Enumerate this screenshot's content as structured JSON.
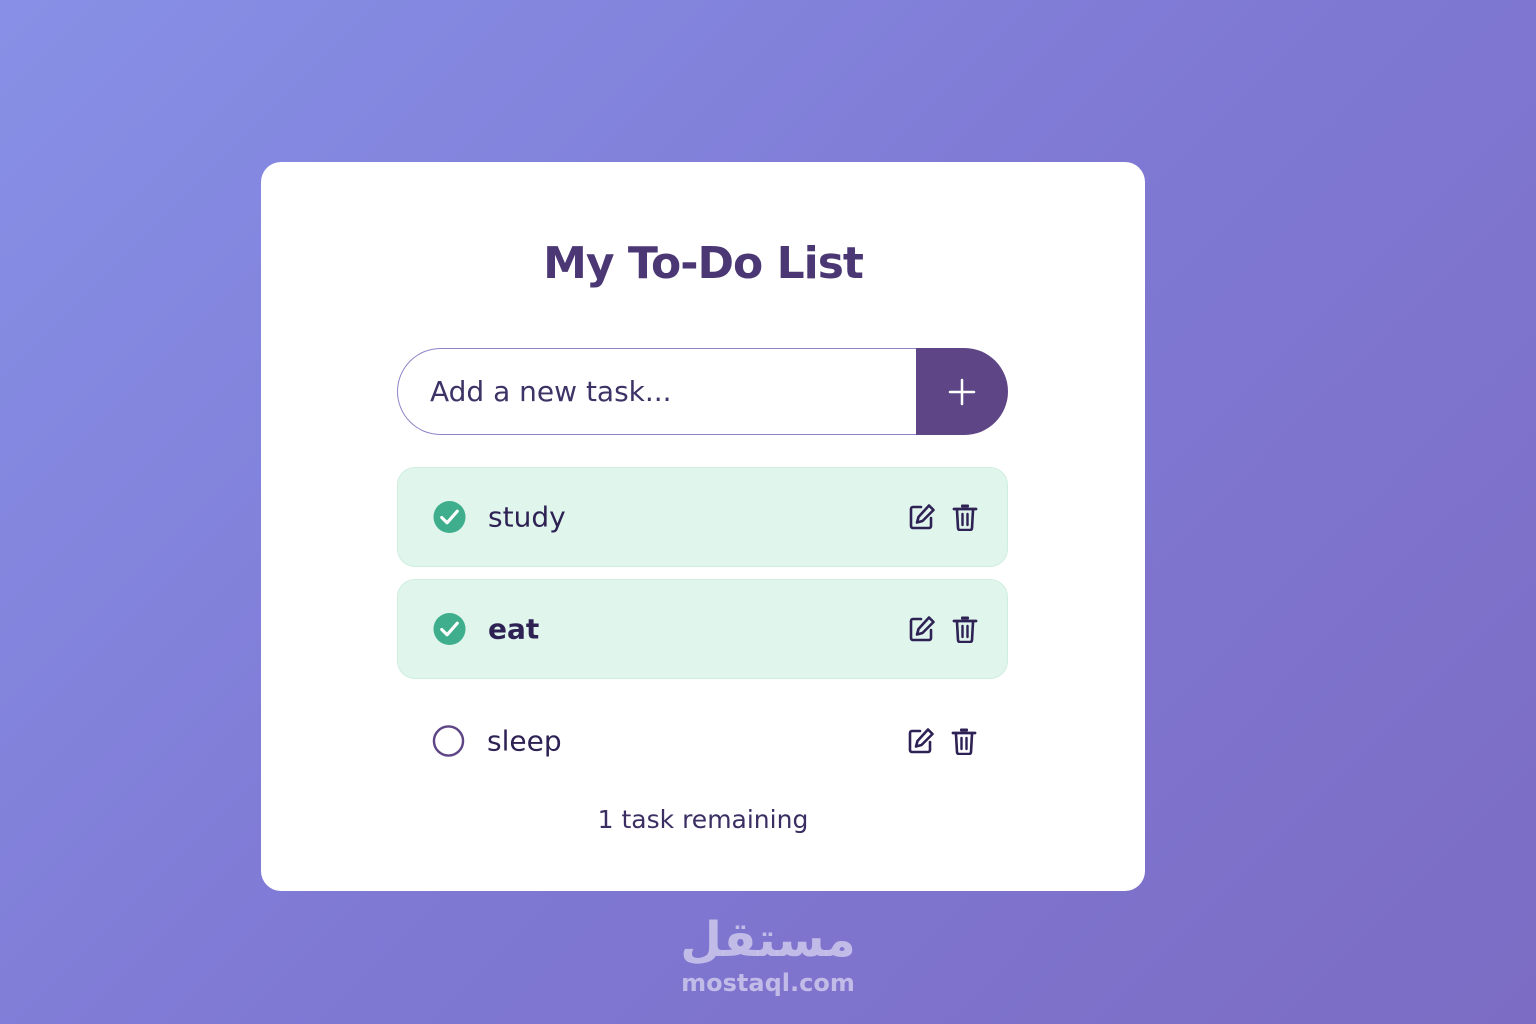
{
  "app": {
    "title": "My To-Do List"
  },
  "add_task": {
    "placeholder": "Add a new task...",
    "button_icon": "plus-icon"
  },
  "tasks": [
    {
      "label": "study",
      "completed": true
    },
    {
      "label": "eat",
      "completed": true
    },
    {
      "label": "sleep",
      "completed": false
    }
  ],
  "footer": {
    "remaining_text": "1 task remaining"
  },
  "watermark": {
    "logo_text": "مستقل",
    "url": "mostaql.com"
  },
  "colors": {
    "accent": "#5e4586",
    "title": "#4a3773",
    "done_background": "#e0f5ec",
    "check_green": "#3fae8c"
  }
}
